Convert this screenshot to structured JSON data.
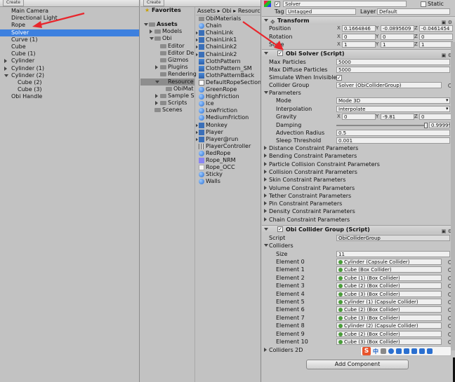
{
  "hierarchy": {
    "create_label": "Create",
    "items": [
      {
        "label": "Main Camera",
        "indent": 0,
        "expander": "none",
        "selected": false
      },
      {
        "label": "Directional Light",
        "indent": 0,
        "expander": "none",
        "selected": false
      },
      {
        "label": "Rope",
        "indent": 0,
        "expander": "none",
        "selected": false
      },
      {
        "label": "Solver",
        "indent": 0,
        "expander": "none",
        "selected": true
      },
      {
        "label": "Curve (1)",
        "indent": 0,
        "expander": "none",
        "selected": false
      },
      {
        "label": "Cube",
        "indent": 0,
        "expander": "none",
        "selected": false
      },
      {
        "label": "Cube (1)",
        "indent": 0,
        "expander": "none",
        "selected": false
      },
      {
        "label": "Cylinder",
        "indent": 0,
        "expander": "collapsed",
        "selected": false
      },
      {
        "label": "Cylinder (1)",
        "indent": 0,
        "expander": "collapsed",
        "selected": false
      },
      {
        "label": "Cylinder (2)",
        "indent": 0,
        "expander": "expanded",
        "selected": false
      },
      {
        "label": "Cube (2)",
        "indent": 1,
        "expander": "none",
        "selected": false
      },
      {
        "label": "Cube (3)",
        "indent": 1,
        "expander": "none",
        "selected": false
      },
      {
        "label": "Obi Handle",
        "indent": 0,
        "expander": "none",
        "selected": false
      }
    ]
  },
  "project": {
    "create_label": "Create",
    "favorites_label": "Favorites",
    "breadcrumb": "Assets ▸ Obi ▸ Resource",
    "tree": [
      {
        "label": "Assets",
        "indent": 0,
        "expander": "expanded",
        "bold": true,
        "selected": false
      },
      {
        "label": "Models",
        "indent": 1,
        "expander": "collapsed",
        "bold": false,
        "selected": false
      },
      {
        "label": "Obi",
        "indent": 1,
        "expander": "expanded",
        "bold": false,
        "selected": false
      },
      {
        "label": "Editor",
        "indent": 2,
        "expander": "none",
        "bold": false,
        "selected": false
      },
      {
        "label": "Editor De",
        "indent": 2,
        "expander": "none",
        "bold": false,
        "selected": false
      },
      {
        "label": "Gizmos",
        "indent": 2,
        "expander": "none",
        "bold": false,
        "selected": false
      },
      {
        "label": "Plugins",
        "indent": 2,
        "expander": "collapsed",
        "bold": false,
        "selected": false
      },
      {
        "label": "Rendering",
        "indent": 2,
        "expander": "none",
        "bold": false,
        "selected": false
      },
      {
        "label": "Resource",
        "indent": 2,
        "expander": "expanded",
        "bold": false,
        "selected": true
      },
      {
        "label": "ObiMat",
        "indent": 3,
        "expander": "none",
        "bold": false,
        "selected": false
      },
      {
        "label": "Sample S",
        "indent": 2,
        "expander": "collapsed",
        "bold": false,
        "selected": false
      },
      {
        "label": "Scripts",
        "indent": 2,
        "expander": "collapsed",
        "bold": false,
        "selected": false
      },
      {
        "label": "Scenes",
        "indent": 1,
        "expander": "none",
        "bold": false,
        "selected": false
      }
    ],
    "assets": [
      {
        "label": "ObiMaterials",
        "icon": "folder",
        "expander": false
      },
      {
        "label": "Chain",
        "icon": "sphere",
        "expander": false
      },
      {
        "label": "ChainLink",
        "icon": "mesh",
        "expander": true
      },
      {
        "label": "ChainLink1",
        "icon": "mesh",
        "expander": true
      },
      {
        "label": "ChainLink2",
        "icon": "mesh",
        "expander": true
      },
      {
        "label": "ChainLink2",
        "icon": "mesh",
        "expander": true
      },
      {
        "label": "ClothPattern",
        "icon": "cloth",
        "expander": false
      },
      {
        "label": "ClothPattern_SM",
        "icon": "cloth",
        "expander": false
      },
      {
        "label": "ClothPatternBack",
        "icon": "cloth",
        "expander": false
      },
      {
        "label": "DefaultRopeSection",
        "icon": "doc",
        "expander": false
      },
      {
        "label": "GreenRope",
        "icon": "sphere",
        "expander": false
      },
      {
        "label": "HighFriction",
        "icon": "sphere",
        "expander": false
      },
      {
        "label": "Ice",
        "icon": "sphere",
        "expander": false
      },
      {
        "label": "LowFriction",
        "icon": "sphere",
        "expander": false
      },
      {
        "label": "MediumFriction",
        "icon": "sphere",
        "expander": false
      },
      {
        "label": "Monkey",
        "icon": "mesh",
        "expander": true
      },
      {
        "label": "Player",
        "icon": "mesh",
        "expander": true
      },
      {
        "label": "Player@run",
        "icon": "mesh",
        "expander": true
      },
      {
        "label": "PlayerController",
        "icon": "grid",
        "expander": false
      },
      {
        "label": "RedRope",
        "icon": "sphere",
        "expander": false
      },
      {
        "label": "Rope_NRM",
        "icon": "purple",
        "expander": false
      },
      {
        "label": "Rope_OCC",
        "icon": "white",
        "expander": false
      },
      {
        "label": "Sticky",
        "icon": "sphere",
        "expander": false
      },
      {
        "label": "Walls",
        "icon": "sphere",
        "expander": false
      }
    ]
  },
  "inspector": {
    "object_name": "Solver",
    "static_label": "Static",
    "tag_label": "Tag",
    "tag_value": "Untagged",
    "layer_label": "Layer",
    "layer_value": "Default",
    "transform": {
      "title": "Transform",
      "position_label": "Position",
      "position": {
        "x": "0.1664846",
        "y": "-0.0895609",
        "z": "-0.0461454"
      },
      "rotation_label": "Rotation",
      "rotation": {
        "x": "0",
        "y": "0",
        "z": "0"
      },
      "scale_label": "Scale",
      "scale": {
        "x": "1",
        "y": "1",
        "z": "1"
      }
    },
    "obi_solver": {
      "title": "Obi Solver (Script)",
      "max_particles_label": "Max Particles",
      "max_particles": "5000",
      "max_diffuse_label": "Max Diffuse Particles",
      "max_diffuse": "5000",
      "simulate_invisible_label": "Simulate When Invisible",
      "simulate_invisible_check": "✓",
      "collider_group_label": "Collider Group",
      "collider_group_value": "Solver (ObiColliderGroup)",
      "parameters_label": "Parameters",
      "mode_label": "Mode",
      "mode_value": "Mode 3D",
      "interpolation_label": "Interpolation",
      "interpolation_value": "Interpolate",
      "gravity_label": "Gravity",
      "gravity": {
        "x": "0",
        "y": "-9.81",
        "z": "0"
      },
      "damping_label": "Damping",
      "damping_value": "0.99999",
      "damping_fraction": 0.99999,
      "advection_label": "Advection Radius",
      "advection_value": "0.5",
      "sleep_label": "Sleep Threshold",
      "sleep_value": "0.001",
      "constraint_groups": [
        "Distance Constraint Parameters",
        "Bending Constraint Parameters",
        "Particle Collision Constraint Parameters",
        "Collision Constraint Parameters",
        "Skin Constraint Parameters",
        "Volume Constraint Parameters",
        "Tether Constraint Parameters",
        "Pin Constraint Parameters",
        "Density Constraint Parameters",
        "Chain Constraint Parameters"
      ]
    },
    "collider_group": {
      "title": "Obi Collider Group (Script)",
      "script_label": "Script",
      "script_value": "ObiColliderGroup",
      "colliders_label": "Colliders",
      "size_label": "Size",
      "size_value": "11",
      "elements": [
        {
          "label": "Element 0",
          "value": "Cylinder (Capsule Collider)"
        },
        {
          "label": "Element 1",
          "value": "Cube (Box Collider)"
        },
        {
          "label": "Element 2",
          "value": "Cube (1) (Box Collider)"
        },
        {
          "label": "Element 3",
          "value": "Cube (2) (Box Collider)"
        },
        {
          "label": "Element 4",
          "value": "Cube (3) (Box Collider)"
        },
        {
          "label": "Element 5",
          "value": "Cylinder (1) (Capsule Collider)"
        },
        {
          "label": "Element 6",
          "value": "Cube (2) (Box Collider)"
        },
        {
          "label": "Element 7",
          "value": "Cube (3) (Box Collider)"
        },
        {
          "label": "Element 8",
          "value": "Cylinder (2) (Capsule Collider)"
        },
        {
          "label": "Element 9",
          "value": "Cube (2) (Box Collider)"
        },
        {
          "label": "Element 10",
          "value": "Cube (3) (Box Collider)"
        }
      ],
      "colliders2d_label": "Colliders 2D"
    },
    "add_component_label": "Add Component",
    "ime_logo": "S",
    "ime_lang": "中"
  },
  "colors": {
    "selection": "#3d80df",
    "annotation_arrow": "#e8262c"
  }
}
